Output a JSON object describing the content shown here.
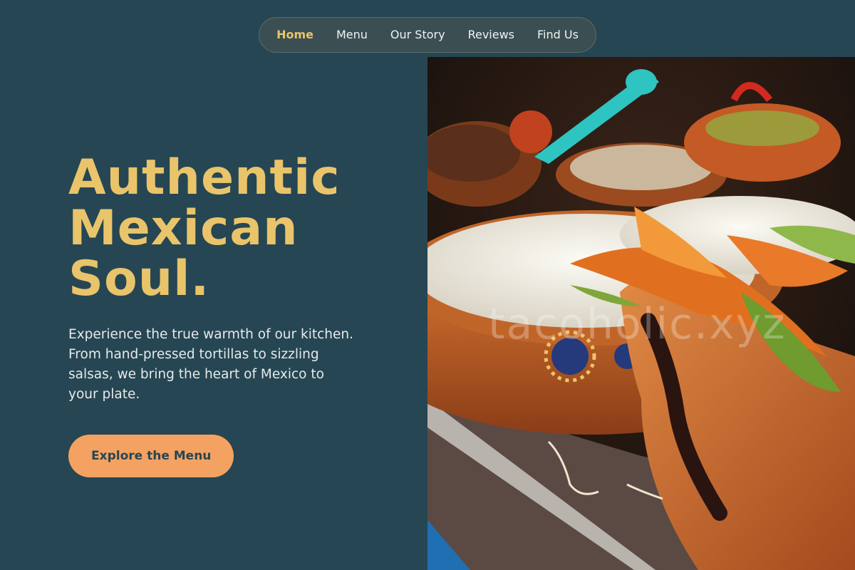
{
  "nav": {
    "items": [
      {
        "label": "Home",
        "active": true
      },
      {
        "label": "Menu",
        "active": false
      },
      {
        "label": "Our Story",
        "active": false
      },
      {
        "label": "Reviews",
        "active": false
      },
      {
        "label": "Find Us",
        "active": false
      }
    ]
  },
  "hero": {
    "title_lines": [
      "Authentic",
      "Mexican",
      "Soul."
    ],
    "description": "Experience the true warmth of our kitchen. From hand-pressed tortillas to sizzling salsas, we bring the heart of Mexico to your plate.",
    "cta_label": "Explore the Menu"
  },
  "photo": {
    "subject": "clay bowls with rice, shredded cheese and squash blossoms",
    "watermark": "tacoholic.xyz"
  },
  "colors": {
    "background": "#264653",
    "accent_gold": "#e9c46a",
    "cta_orange": "#f4a261",
    "nav_pill": "#3b4f53"
  }
}
